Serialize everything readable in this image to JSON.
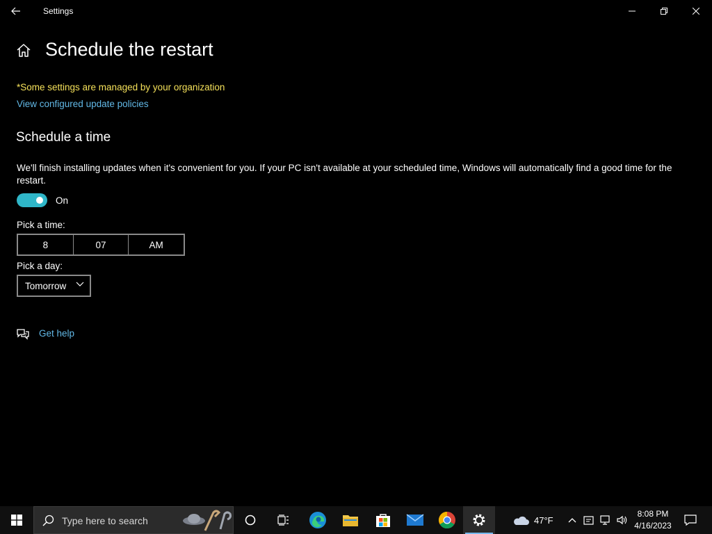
{
  "window": {
    "title": "Settings",
    "controls": [
      "minimize",
      "restore",
      "close"
    ]
  },
  "page": {
    "title": "Schedule the restart",
    "org_note": "*Some settings are managed by your organization",
    "policy_link": "View configured update policies"
  },
  "schedule": {
    "section_title": "Schedule a time",
    "description": "We'll finish installing updates when it's convenient for you. If your PC isn't available at your scheduled time, Windows will automatically find a good time for the restart.",
    "toggle_state": "On",
    "toggle_on": true,
    "toggle_color": "#2fb6c8",
    "pick_time_label": "Pick a time:",
    "time": {
      "hour": "8",
      "minute": "07",
      "period": "AM"
    },
    "pick_day_label": "Pick a day:",
    "day_value": "Tomorrow"
  },
  "help": {
    "label": "Get help"
  },
  "taskbar": {
    "search_placeholder": "Type here to search",
    "apps": [
      "cortana",
      "task-view",
      "edge",
      "file-explorer",
      "microsoft-store",
      "mail",
      "chrome",
      "settings"
    ],
    "active_app": "settings",
    "weather_temp": "47°F",
    "time": "8:08 PM",
    "date": "4/16/2023"
  },
  "colors": {
    "background": "#000000",
    "link": "#62b8e6",
    "warning": "#f5e15a",
    "accent": "#2fb6c8"
  }
}
